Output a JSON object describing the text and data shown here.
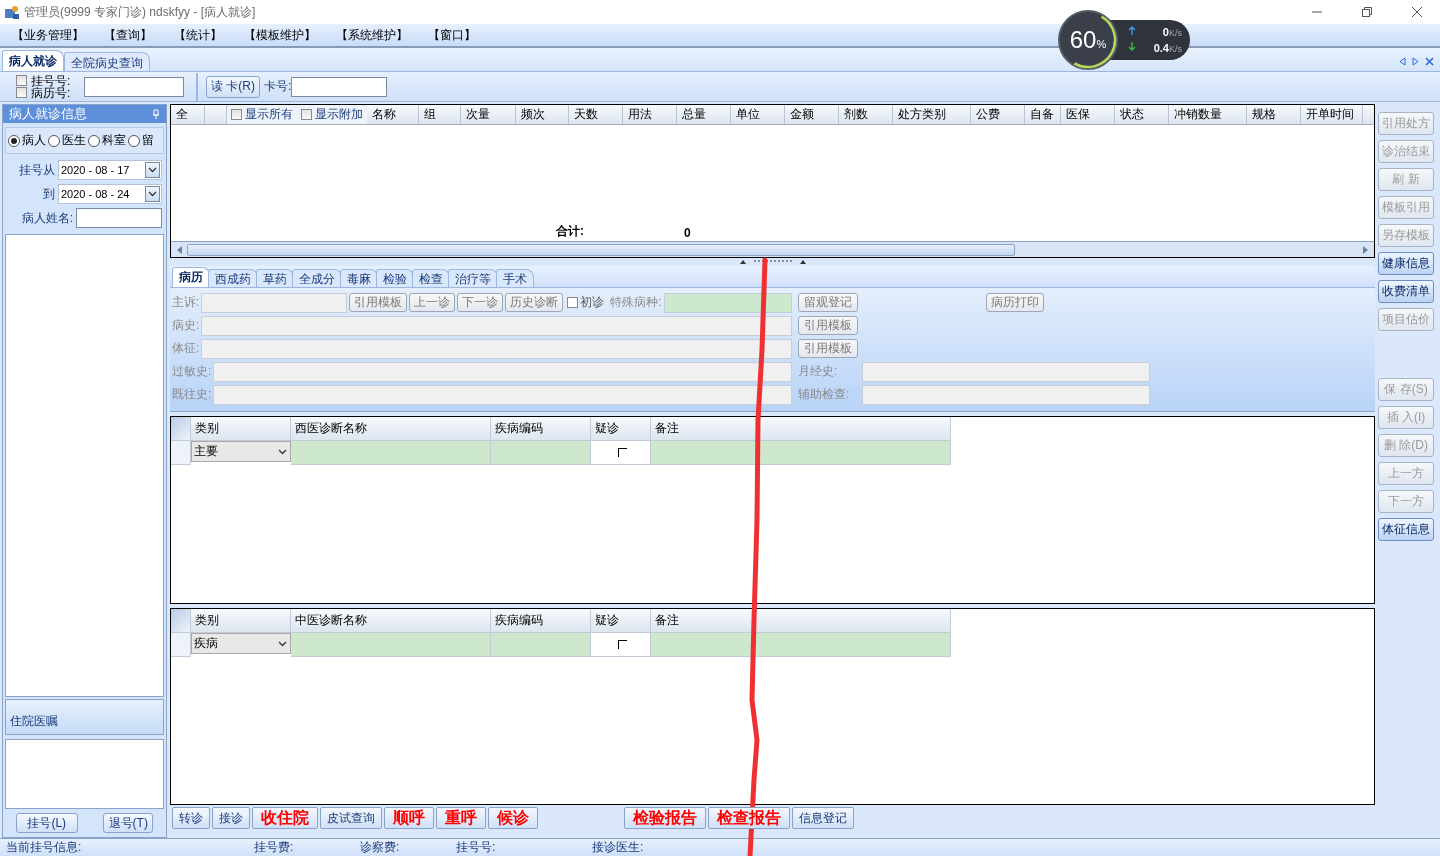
{
  "window": {
    "title": "管理员(9999 专家门诊) ndskfyy - [病人就诊]"
  },
  "menu": [
    "【业务管理】",
    "【查询】",
    "【统计】",
    "【模板维护】",
    "【系统维护】",
    "【窗口】"
  ],
  "net_widget": {
    "percent": "60",
    "unit": "%",
    "up": "0",
    "up_unit": "K/s",
    "down": "0.4",
    "down_unit": "K/s"
  },
  "doc_tabs": [
    {
      "label": "病人就诊",
      "selected": true
    },
    {
      "label": "全院病史查询",
      "selected": false
    }
  ],
  "toolbar": {
    "id_checks": [
      {
        "label": "挂号号:",
        "checked": false
      },
      {
        "label": "病历号:",
        "checked": false
      }
    ],
    "read_card": "读 卡(R)",
    "card_label": "卡号:"
  },
  "left_panel": {
    "title": "病人就诊信息",
    "filters": [
      {
        "label": "病人",
        "selected": true
      },
      {
        "label": "医生",
        "selected": false
      },
      {
        "label": "科室",
        "selected": false
      },
      {
        "label": "留",
        "selected": false
      }
    ],
    "date_from_label": "挂号从",
    "date_from": "2020 - 08 - 17",
    "date_to_label": "到",
    "date_to": "2020 - 08 - 24",
    "name_label": "病人姓名:",
    "orders_title": "住院医嘱",
    "buttons": [
      "挂号(L)",
      "退号(T)"
    ]
  },
  "rx_grid": {
    "columns": [
      "全",
      "",
      "名称",
      "组",
      "次量",
      "频次",
      "天数",
      "用法",
      "总量",
      "单位",
      "金额",
      "剂数",
      "处方类别",
      "公费",
      "自备",
      "医保",
      "状态",
      "冲销数量",
      "规格",
      "开单时间"
    ],
    "header_checks": [
      {
        "label": "显示所有",
        "checked": false
      },
      {
        "label": "显示附加",
        "checked": false
      }
    ],
    "total_label": "合计:",
    "total": "0"
  },
  "record_tabs": [
    {
      "label": "病历",
      "selected": true
    },
    {
      "label": "西成药",
      "selected": false
    },
    {
      "label": "草药",
      "selected": false
    },
    {
      "label": "全成分",
      "selected": false
    },
    {
      "label": "毒麻",
      "selected": false
    },
    {
      "label": "检验",
      "selected": false
    },
    {
      "label": "检查",
      "selected": false
    },
    {
      "label": "治疗等",
      "selected": false
    },
    {
      "label": "手术",
      "selected": false
    }
  ],
  "record_form": {
    "complaint": "主诉:",
    "complaint_buttons": [
      "引用模板",
      "上一诊",
      "下一诊",
      "历史诊断"
    ],
    "first_visit": {
      "label": "初诊",
      "checked": false
    },
    "special_label": "特殊病种:",
    "observe_button": "留观登记",
    "print_button": "病历打印",
    "history": "病史:",
    "history_button": "引用模板",
    "signs": "体征:",
    "signs_button": "引用模板",
    "allergy": "过敏史:",
    "menstrual": "月经史:",
    "past": "既往史:",
    "aux_exam": "辅助检查:"
  },
  "diag_grids": [
    {
      "columns": [
        "类别",
        "西医诊断名称",
        "疾病编码",
        "疑诊",
        "备注"
      ],
      "rows": [
        {
          "category": "主要",
          "suspected": false
        }
      ]
    },
    {
      "columns": [
        "类别",
        "中医诊断名称",
        "疾病编码",
        "疑诊",
        "备注"
      ],
      "rows": [
        {
          "category": "疾病",
          "suspected": false
        }
      ]
    }
  ],
  "bottom_button_groups": [
    [
      {
        "label": "转诊",
        "emphasis": false
      },
      {
        "label": "接诊",
        "emphasis": false
      },
      {
        "label": "收住院",
        "emphasis": true
      },
      {
        "label": "皮试查询",
        "emphasis": false
      },
      {
        "label": "顺呼",
        "emphasis": true
      },
      {
        "label": "重呼",
        "emphasis": true
      },
      {
        "label": "候诊",
        "emphasis": true
      }
    ],
    [
      {
        "label": "检验报告",
        "emphasis": true
      },
      {
        "label": "检查报告",
        "emphasis": true
      },
      {
        "label": "信息登记",
        "emphasis": false
      }
    ]
  ],
  "side_button_groups": [
    [
      {
        "label": "引用处方",
        "disabled": true
      },
      {
        "label": "诊治结束",
        "disabled": true
      },
      {
        "label": "刷 新",
        "disabled": true
      },
      {
        "label": "模板引用",
        "disabled": true
      },
      {
        "label": "另存模板",
        "disabled": true
      },
      {
        "label": "健康信息",
        "disabled": false
      },
      {
        "label": "收费清单",
        "disabled": false
      },
      {
        "label": "项目估价",
        "disabled": true
      }
    ],
    [
      {
        "label": "保 存(S)",
        "disabled": true
      },
      {
        "label": "插 入(I)",
        "disabled": true
      },
      {
        "label": "删 除(D)",
        "disabled": true
      },
      {
        "label": "上一方",
        "disabled": true
      },
      {
        "label": "下一方",
        "disabled": true
      },
      {
        "label": "体征信息",
        "disabled": false
      }
    ]
  ],
  "status_bar": [
    "当前挂号信息:",
    "挂号费:",
    "诊察费:",
    "挂号号:",
    "接诊医生:"
  ]
}
